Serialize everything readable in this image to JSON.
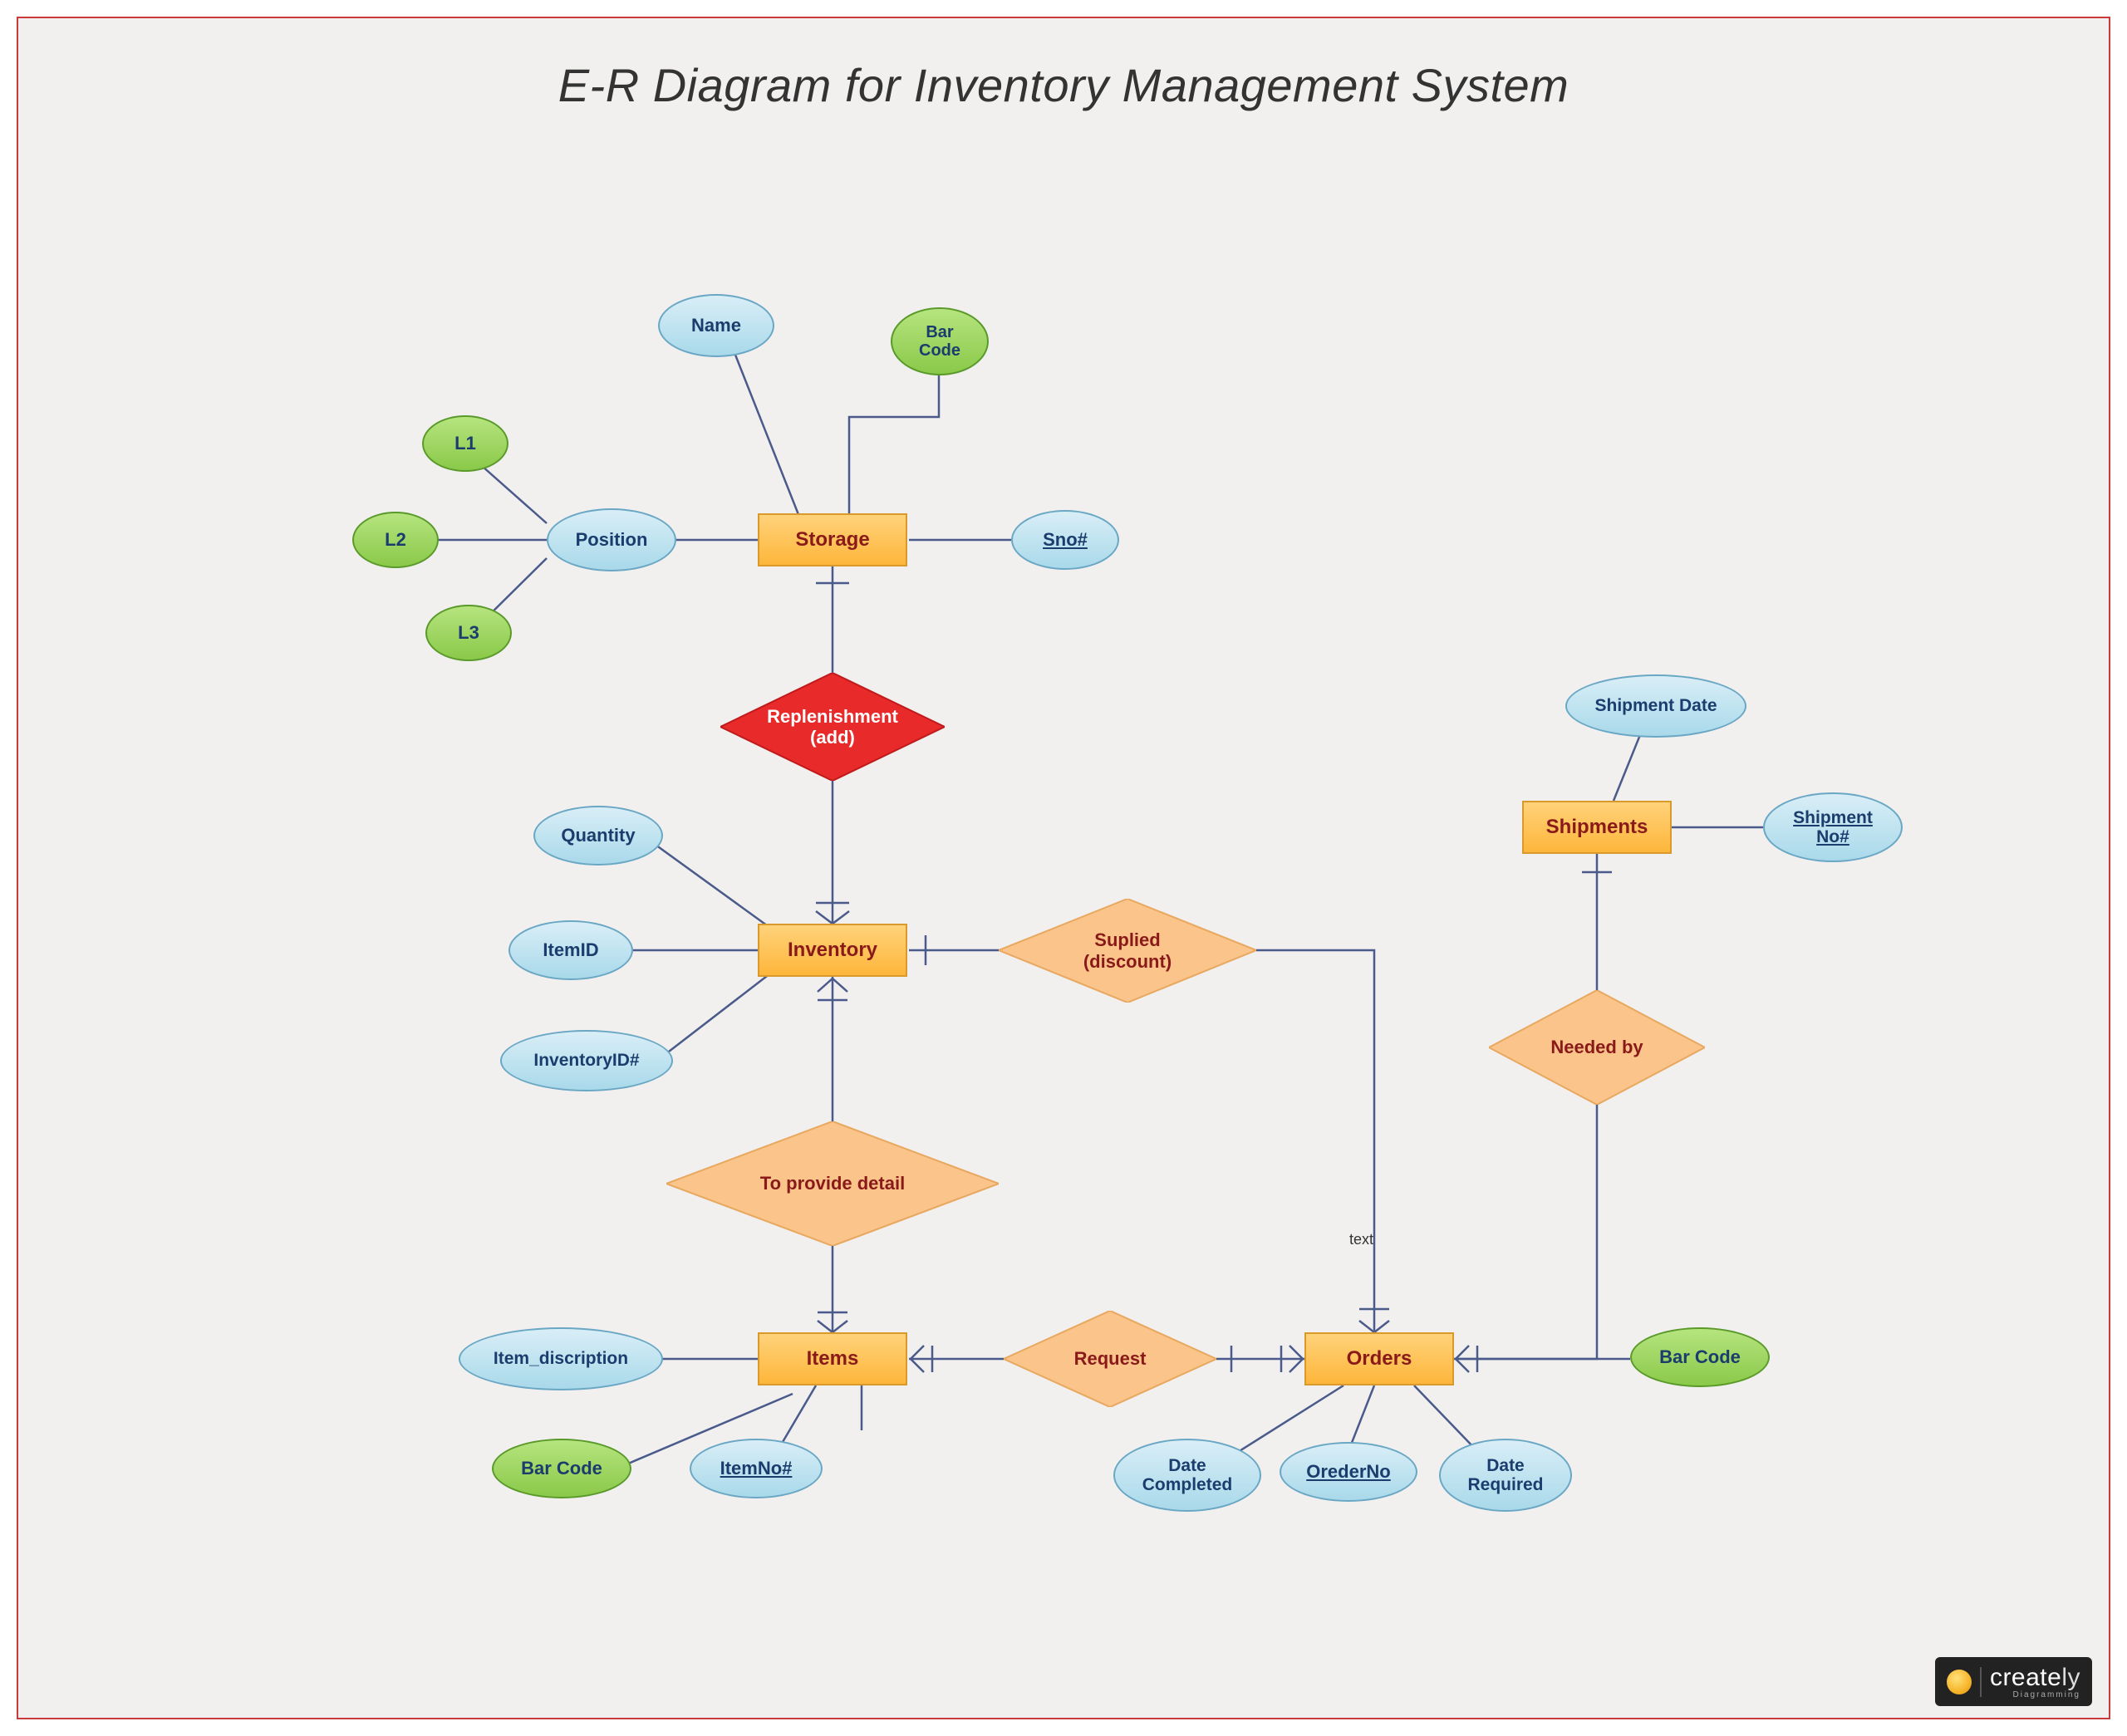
{
  "title": "E-R Diagram for Inventory Management System",
  "entities": {
    "storage": "Storage",
    "inventory": "Inventory",
    "items": "Items",
    "orders": "Orders",
    "shipments": "Shipments"
  },
  "relationships": {
    "replenishment": "Replenishment\n(add)",
    "supplied": "Suplied\n(discount)",
    "toprovide": "To provide detail",
    "request": "Request",
    "neededby": "Needed by"
  },
  "attributes": {
    "storage": {
      "name": "Name",
      "barcode": "Bar\nCode",
      "sno": "Sno#",
      "position": "Position",
      "position_sub": {
        "l1": "L1",
        "l2": "L2",
        "l3": "L3"
      }
    },
    "inventory": {
      "quantity": "Quantity",
      "itemid": "ItemID",
      "inventoryid": "InventoryID#"
    },
    "items": {
      "item_description": "Item_discription",
      "barcode": "Bar Code",
      "itemno": "ItemNo#"
    },
    "orders": {
      "date_completed": "Date\nCompleted",
      "orderno": "OrederNo",
      "date_required": "Date\nRequired",
      "barcode": "Bar Code"
    },
    "shipments": {
      "shipment_date": "Shipment Date",
      "shipment_no": "Shipment\nNo#"
    }
  },
  "labels": {
    "text": "text"
  },
  "watermark": {
    "brand1": "create",
    "brand2": "ly",
    "sub": "Diagramming"
  }
}
